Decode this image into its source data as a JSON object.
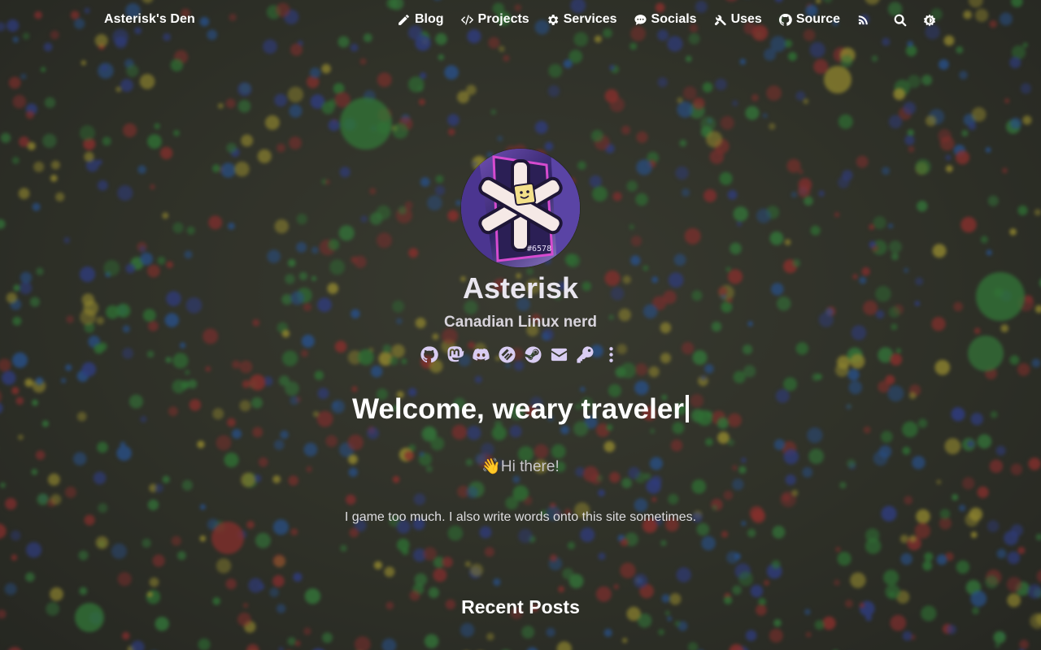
{
  "nav": {
    "brand": "Asterisk's Den",
    "items": [
      {
        "label": "Blog",
        "icon": "pencil-icon"
      },
      {
        "label": "Projects",
        "icon": "code-icon"
      },
      {
        "label": "Services",
        "icon": "gear-icon"
      },
      {
        "label": "Socials",
        "icon": "chat-bubble-icon"
      },
      {
        "label": "Uses",
        "icon": "tools-icon"
      },
      {
        "label": "Source",
        "icon": "github-icon"
      }
    ],
    "tools": [
      "rss-icon",
      "search-icon",
      "theme-toggle-icon"
    ]
  },
  "profile": {
    "avatar_caption": "#6578",
    "name": "Asterisk",
    "tagline": "Canadian Linux nerd",
    "socials": [
      "github-icon",
      "mastodon-icon",
      "discord-icon",
      "fediverse-icon",
      "steam-icon",
      "mail-icon",
      "key-icon",
      "more-icon"
    ]
  },
  "hero": {
    "welcome": "Welcome, weary traveler",
    "hi_emoji": "👋",
    "hi": "Hi there!",
    "bio": "I game too much. I also write words onto this site sometimes."
  },
  "recent": {
    "title": "Recent Posts"
  },
  "colors": {
    "accent": "#d9cdf2",
    "text": "#ffffff"
  }
}
